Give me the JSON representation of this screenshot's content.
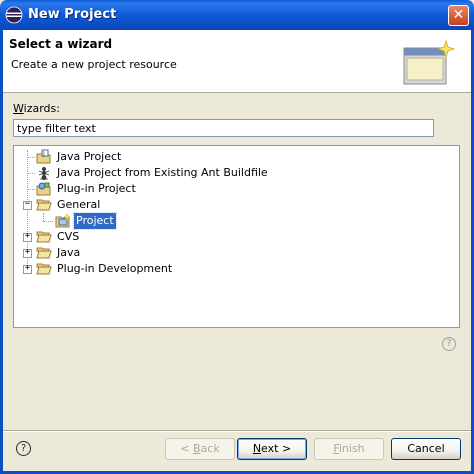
{
  "window": {
    "title": "New Project"
  },
  "header": {
    "title": "Select a wizard",
    "description": "Create a new project resource"
  },
  "wizards": {
    "label_underline": "W",
    "label_rest": "izards:",
    "filter_value": "type filter text"
  },
  "tree": {
    "items": [
      {
        "label": "Java Project",
        "icon": "java-project-icon"
      },
      {
        "label": "Java Project from Existing Ant Buildfile",
        "icon": "ant-icon"
      },
      {
        "label": "Plug-in Project",
        "icon": "plugin-project-icon"
      },
      {
        "label": "General",
        "icon": "folder-open-icon",
        "expander": "−"
      },
      {
        "label": "Project",
        "icon": "project-icon",
        "selected": true
      },
      {
        "label": "CVS",
        "icon": "folder-icon",
        "expander": "+"
      },
      {
        "label": "Java",
        "icon": "folder-icon",
        "expander": "+"
      },
      {
        "label": "Plug-in Development",
        "icon": "folder-icon",
        "expander": "+"
      }
    ]
  },
  "help_symbol": "?",
  "close_symbol": "✕",
  "buttons": {
    "back": {
      "prefix": "< ",
      "underline": "B",
      "rest": "ack"
    },
    "next": {
      "underline": "N",
      "rest": "ext >"
    },
    "finish": {
      "underline": "F",
      "rest": "inish"
    },
    "cancel": {
      "label": "Cancel"
    }
  },
  "colors": {
    "titlebar": "#0a5fd8",
    "selection": "#316ac5",
    "dialog_bg": "#ece9d8"
  }
}
